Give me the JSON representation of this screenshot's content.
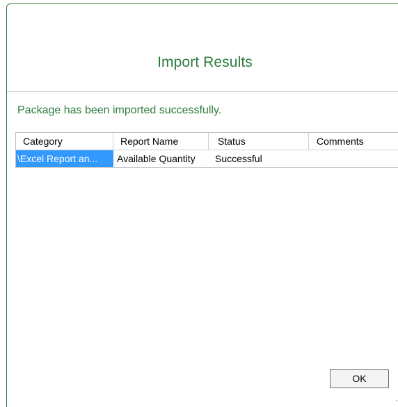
{
  "dialog": {
    "title": "Import Results",
    "message": "Package has been imported successfully."
  },
  "grid": {
    "columns": [
      "Category",
      "Report Name",
      "Status",
      "Comments"
    ],
    "rows": [
      {
        "category": "\\Excel Report an...",
        "report_name": "Available Quantity",
        "status": "Successful",
        "comments": ""
      }
    ]
  },
  "buttons": {
    "ok_label": "OK"
  },
  "colors": {
    "accent": "#2f7d3f",
    "selection": "#3399ff"
  }
}
